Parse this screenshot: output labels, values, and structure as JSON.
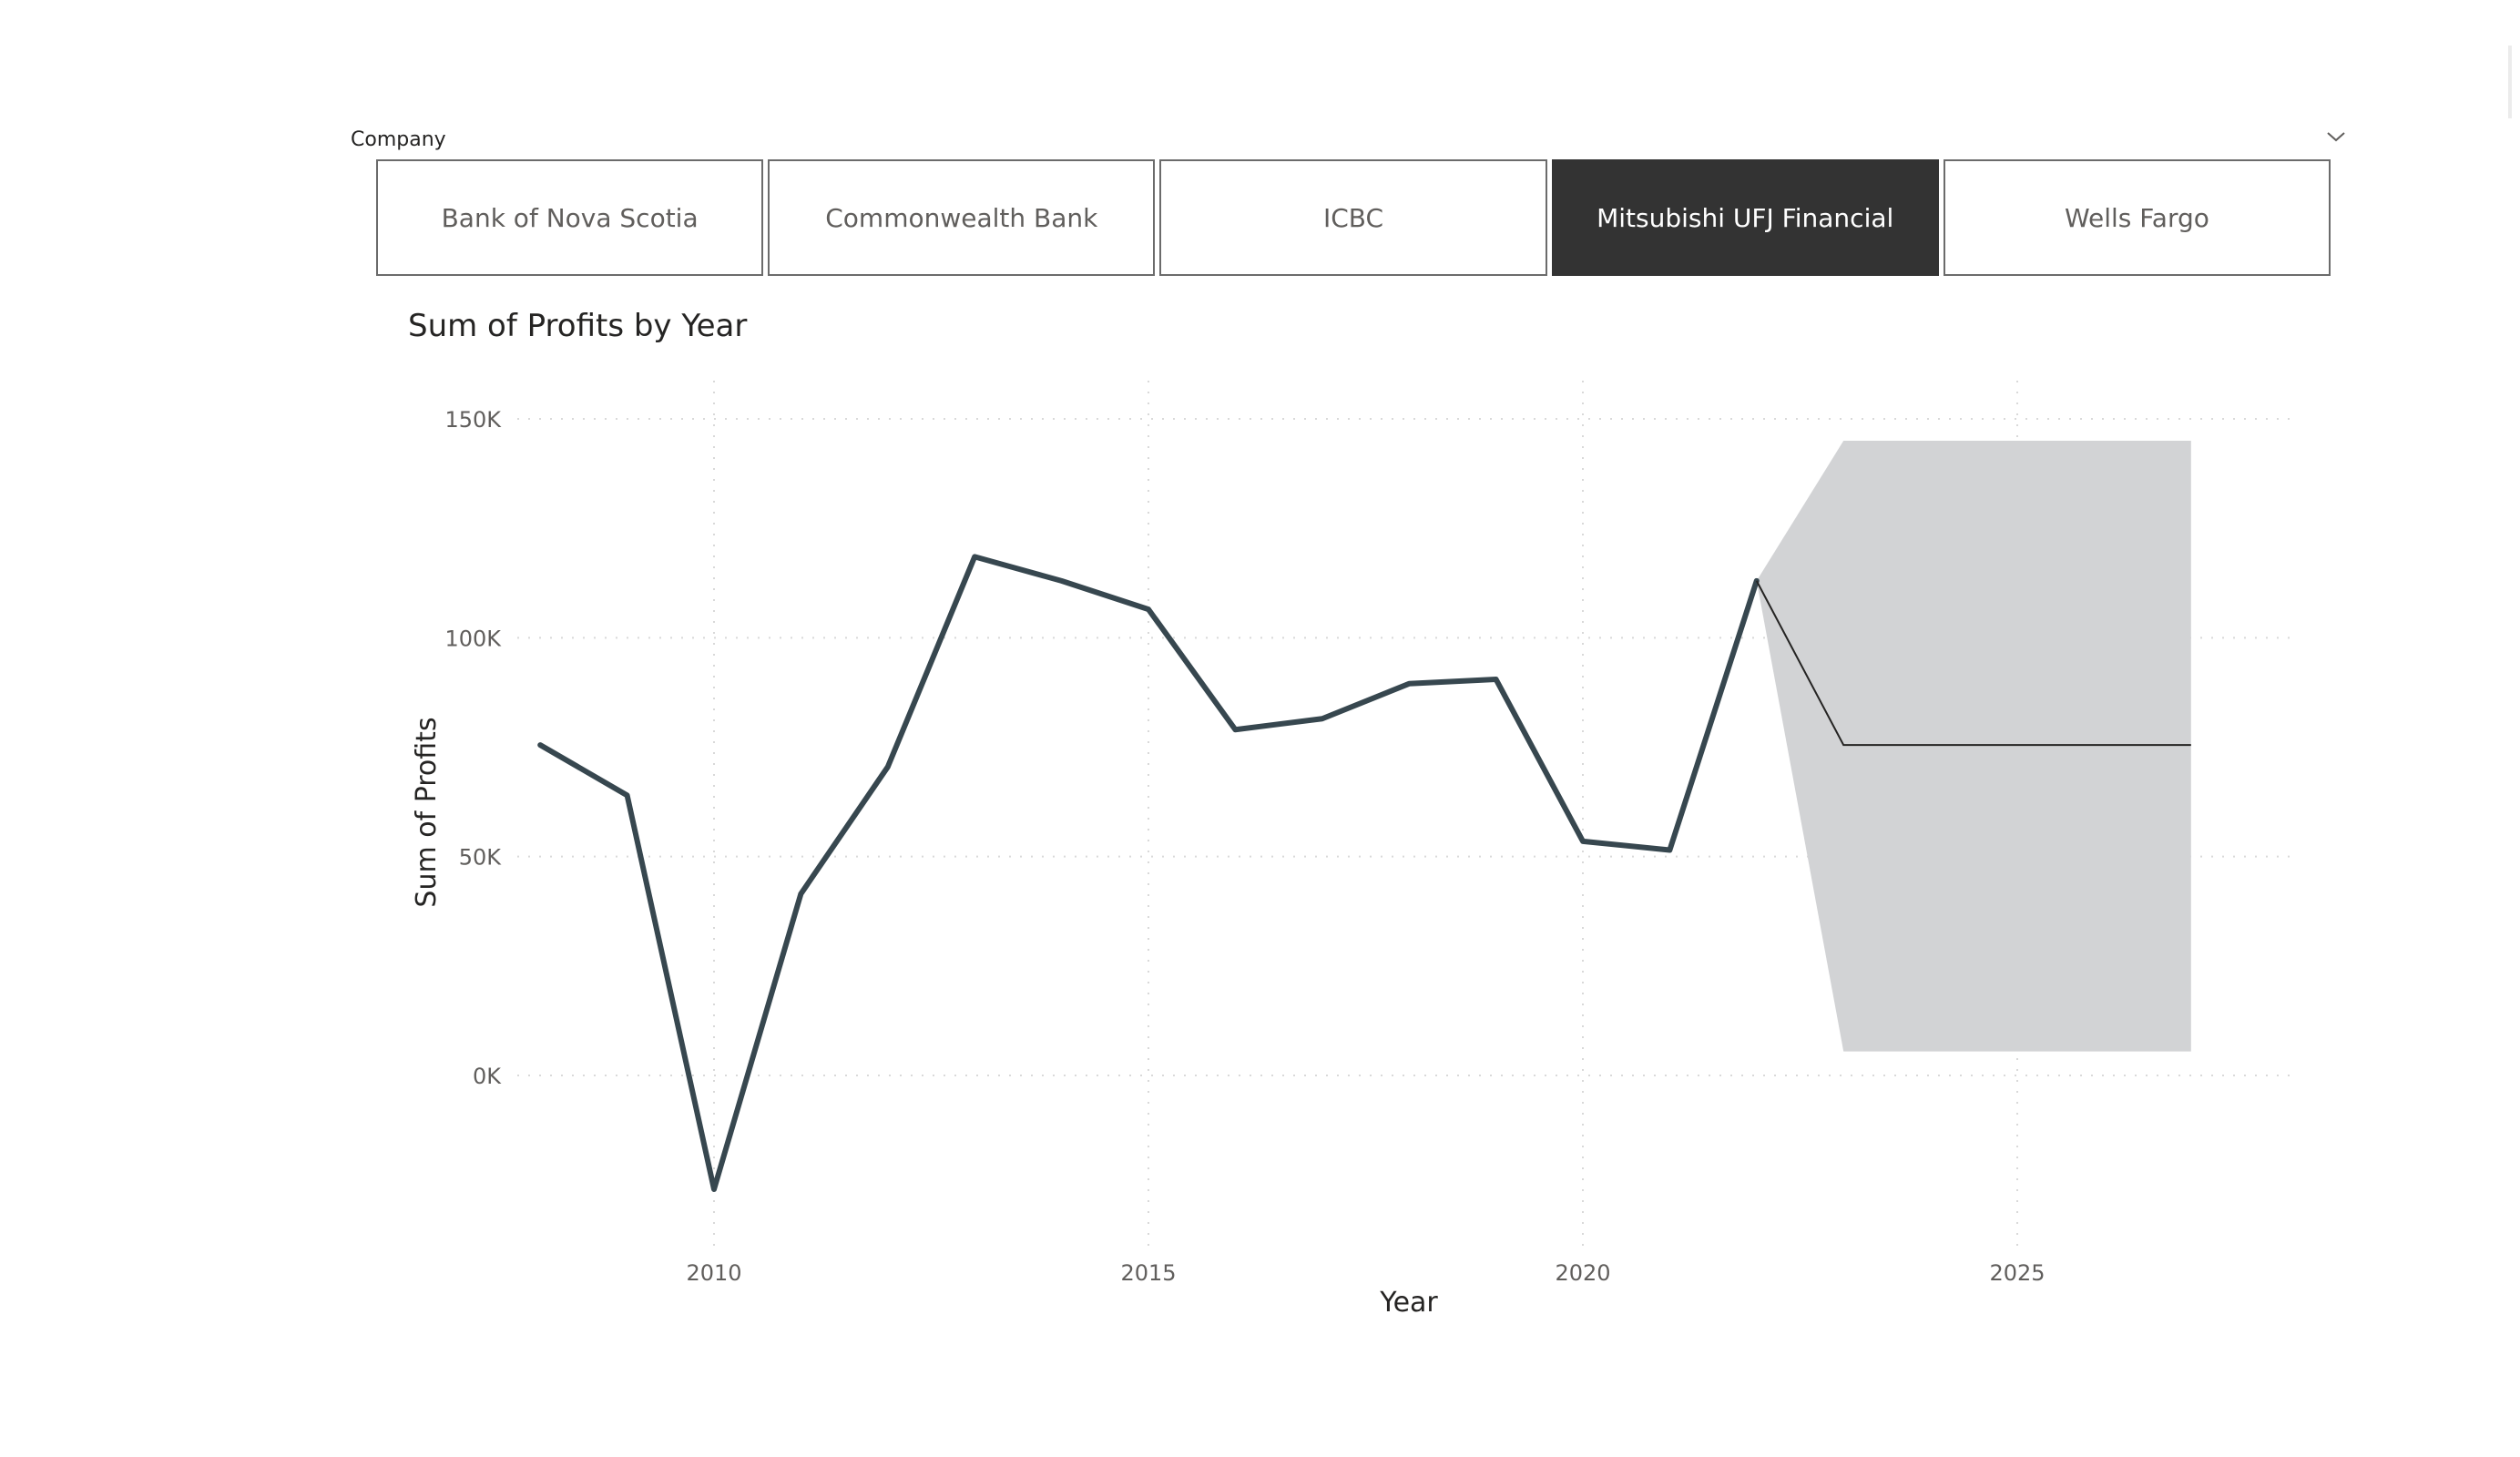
{
  "slicer": {
    "header": "Company",
    "options": [
      {
        "label": "Bank of Nova Scotia",
        "selected": false
      },
      {
        "label": "Commonwealth Bank",
        "selected": false
      },
      {
        "label": "ICBC",
        "selected": false
      },
      {
        "label": "Mitsubishi UFJ Financial",
        "selected": true
      },
      {
        "label": "Wells Fargo",
        "selected": false
      }
    ]
  },
  "chart_data": {
    "type": "line",
    "title": "Sum of Profits by Year",
    "xlabel": "Year",
    "ylabel": "Sum of Profits",
    "xlim": [
      2007.5,
      2028.3
    ],
    "ylim": [
      -38000,
      160000
    ],
    "x_ticks": [
      {
        "value": 2010,
        "label": "2010"
      },
      {
        "value": 2015,
        "label": "2015"
      },
      {
        "value": 2020,
        "label": "2020"
      },
      {
        "value": 2025,
        "label": "2025"
      }
    ],
    "y_ticks": [
      {
        "value": 0,
        "label": "0K"
      },
      {
        "value": 50000,
        "label": "50K"
      },
      {
        "value": 100000,
        "label": "100K"
      },
      {
        "value": 150000,
        "label": "150K"
      }
    ],
    "grid": true,
    "series": [
      {
        "color": "#37474f",
        "x": [
          2008,
          2009,
          2010,
          2011,
          2012,
          2013,
          2014,
          2015,
          2016,
          2017,
          2018,
          2019,
          2020,
          2021,
          2022
        ],
        "values": [
          75500,
          64000,
          -26000,
          41500,
          70500,
          118500,
          113000,
          106500,
          79000,
          81500,
          89500,
          90500,
          53500,
          51500,
          113000
        ]
      }
    ],
    "forecast": {
      "line_color": "#252423",
      "band_color": "#d2d3d5",
      "x": [
        2022,
        2023,
        2027
      ],
      "values": [
        113000,
        75500,
        75500
      ],
      "upper": [
        113000,
        145000,
        145000
      ],
      "lower": [
        113000,
        5500,
        5500
      ]
    }
  }
}
